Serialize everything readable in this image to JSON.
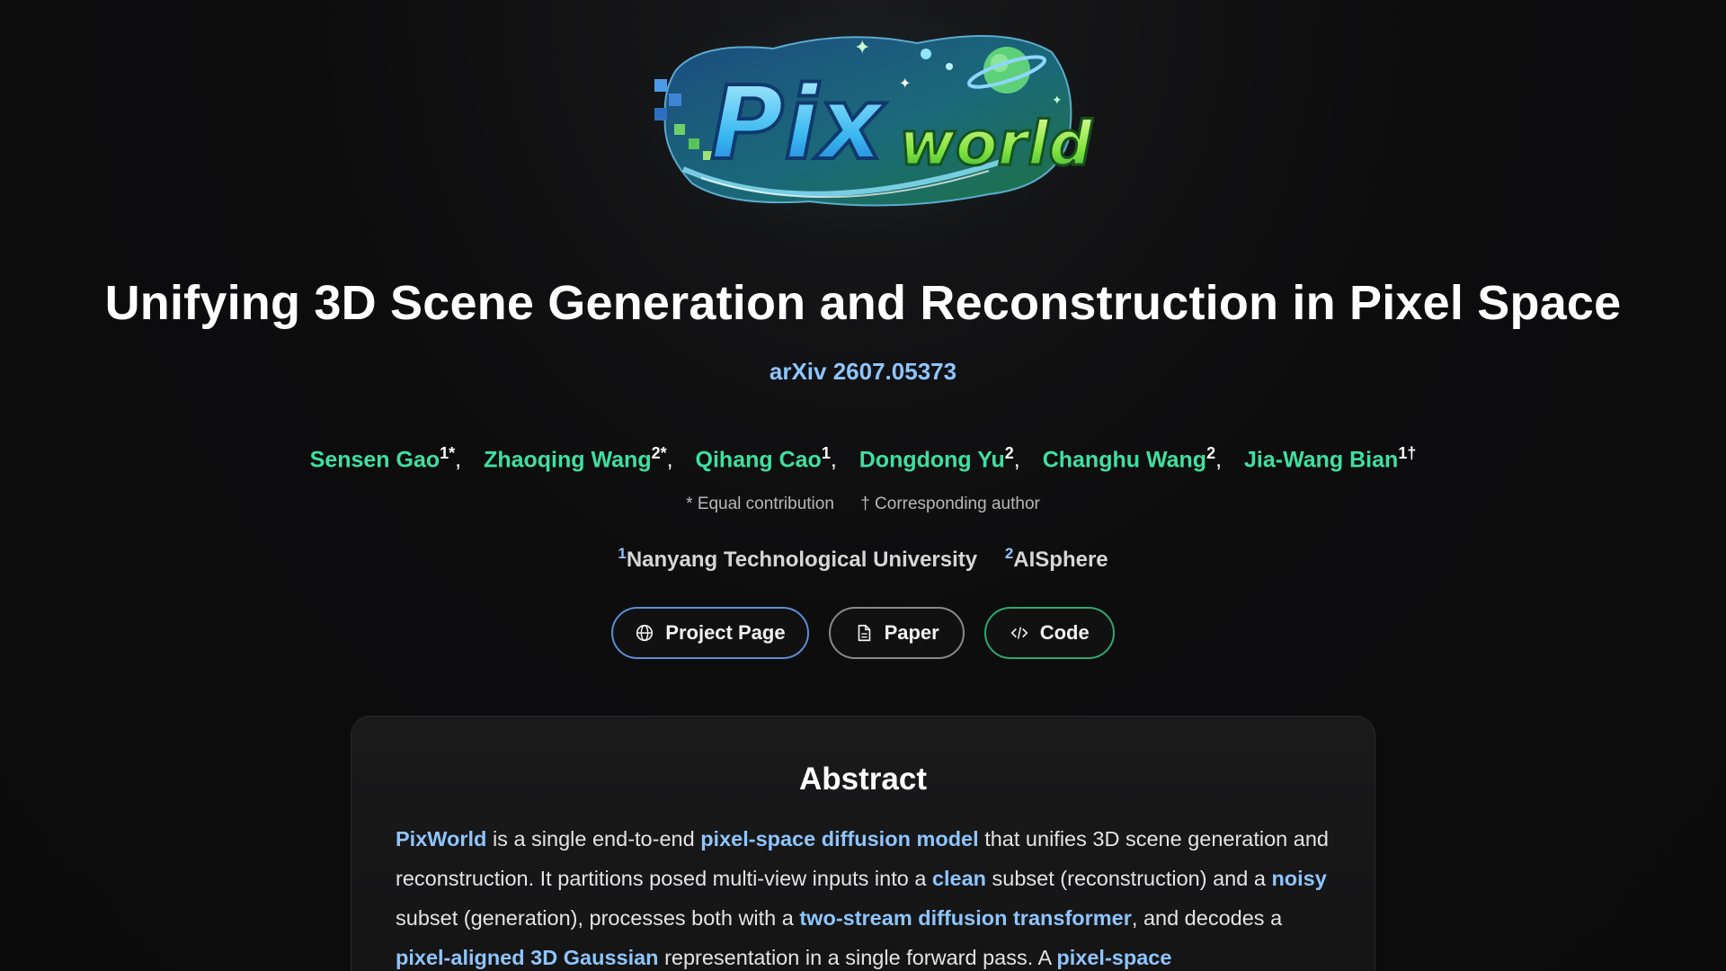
{
  "logo": {
    "text_pix": "Pix",
    "text_world": "world"
  },
  "title": "Unifying 3D Scene Generation and Reconstruction in Pixel Space",
  "arxiv": "arXiv 2607.05373",
  "authors": [
    {
      "name": "Sensen Gao",
      "sup": "1*"
    },
    {
      "name": "Zhaoqing Wang",
      "sup": "2*"
    },
    {
      "name": "Qihang Cao",
      "sup": "1"
    },
    {
      "name": "Dongdong Yu",
      "sup": "2"
    },
    {
      "name": "Changhu Wang",
      "sup": "2"
    },
    {
      "name": "Jia-Wang Bian",
      "sup": "1†"
    }
  ],
  "separator": ",",
  "notes": {
    "equal": "* Equal contribution",
    "corresponding": "† Corresponding author"
  },
  "affiliations": [
    {
      "sup": "1",
      "name": "Nanyang Technological University"
    },
    {
      "sup": "2",
      "name": "AISphere"
    }
  ],
  "buttons": {
    "project": "Project Page",
    "paper": "Paper",
    "code": "Code"
  },
  "icons": {
    "project": "globe-icon",
    "paper": "document-icon",
    "code": "code-icon"
  },
  "abstract": {
    "heading": "Abstract",
    "segments": [
      {
        "t": "PixWorld",
        "hl": true
      },
      {
        "t": " is a single end-to-end ",
        "hl": false
      },
      {
        "t": "pixel-space diffusion model",
        "hl": true
      },
      {
        "t": " that unifies 3D scene generation and reconstruction. It partitions posed multi-view inputs into a ",
        "hl": false
      },
      {
        "t": "clean",
        "hl": true
      },
      {
        "t": " subset (reconstruction) and a ",
        "hl": false
      },
      {
        "t": "noisy",
        "hl": true
      },
      {
        "t": " subset (generation), processes both with a ",
        "hl": false
      },
      {
        "t": "two-stream diffusion transformer",
        "hl": true
      },
      {
        "t": ", and decodes a ",
        "hl": false
      },
      {
        "t": "pixel-aligned 3D Gaussian",
        "hl": true
      },
      {
        "t": " representation in a single forward pass. A ",
        "hl": false
      },
      {
        "t": "pixel-space",
        "hl": true
      }
    ]
  },
  "colors": {
    "background": "#0b0b0c",
    "author": "#3ee0a0",
    "link": "#8ec5ff",
    "project_border": "#5b8fd6",
    "paper_border": "#8a8a8a",
    "code_border": "#2ea86e"
  }
}
